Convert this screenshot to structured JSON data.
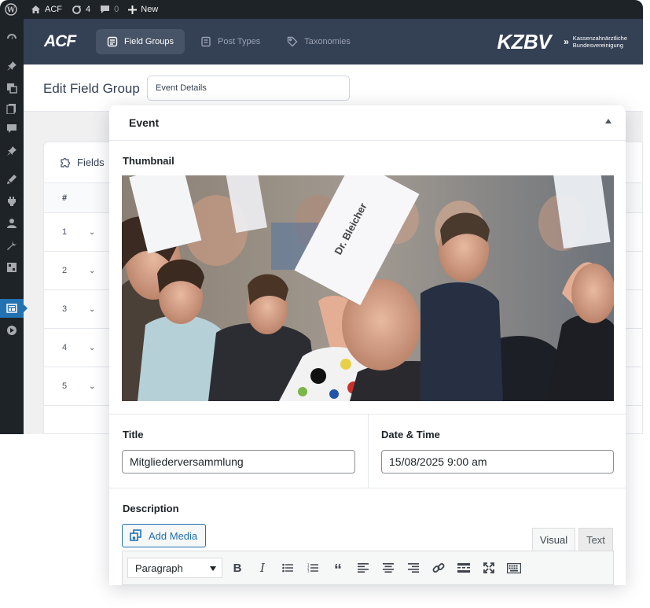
{
  "adminbar": {
    "site_name": "ACF",
    "updates_count": "4",
    "comments_count": "0",
    "new_label": "New"
  },
  "acf": {
    "logo_text": "ACF",
    "tabs": [
      {
        "label": "Field Groups",
        "icon": "field-groups-icon",
        "active": true
      },
      {
        "label": "Post Types",
        "icon": "post-types-icon",
        "active": false
      },
      {
        "label": "Taxonomies",
        "icon": "taxonomies-icon",
        "active": false
      }
    ],
    "brand_word": "KZBV",
    "brand_sub_line1": "Kassenzahnärztliche",
    "brand_sub_line2": "Bundesvereinigung"
  },
  "edit": {
    "title": "Edit Field Group",
    "group_name_value": "Event Details"
  },
  "fields_panel": {
    "tab_label": "Fields",
    "col_number": "#",
    "rows": [
      "1",
      "2",
      "3",
      "4",
      "5"
    ]
  },
  "event": {
    "heading": "Event",
    "thumbnail_label": "Thumbnail",
    "placard_text": "Dr. Bleicher",
    "title_label": "Title",
    "title_value": "Mitgliederversammlung",
    "datetime_label": "Date & Time",
    "datetime_value": "15/08/2025 9:00 am",
    "description_label": "Description",
    "add_media_label": "Add Media",
    "tab_visual": "Visual",
    "tab_text": "Text",
    "format_select_value": "Paragraph"
  },
  "colors": {
    "wp_dark": "#1d2327",
    "acf_header": "#344054",
    "acf_active_tab": "#475467",
    "wp_blue": "#2271b1"
  }
}
